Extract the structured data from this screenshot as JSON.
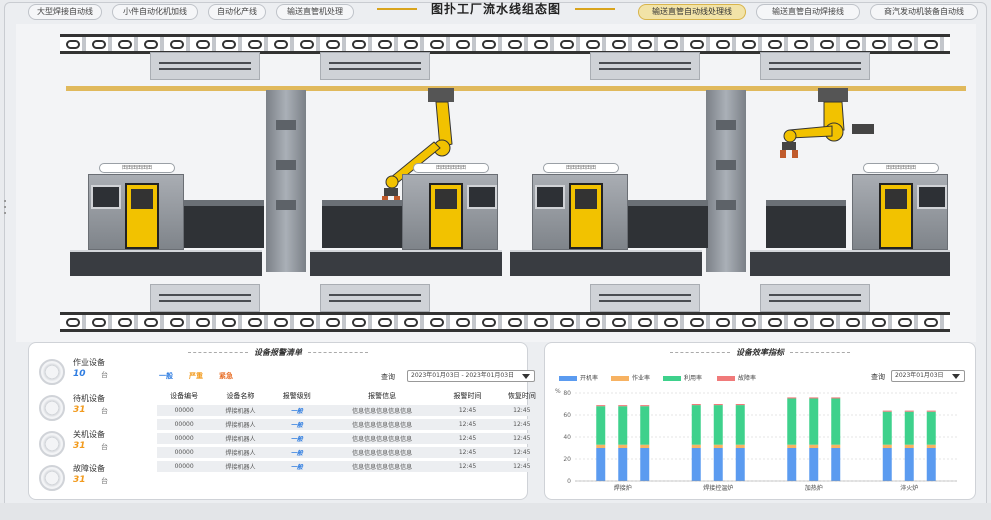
{
  "nav": {
    "left_tabs": [
      "大型焊接自动线",
      "小件自动化机加线",
      "自动化产线",
      "输送直管机处理"
    ],
    "title": "图扑工厂流水线组态图",
    "right_tabs": [
      "输送直管自动线处理线",
      "输送直管自动焊接线",
      "商汽发动机装备自动线"
    ],
    "active_right_index": 0
  },
  "scene": {
    "machine_tag": "田田田田田田"
  },
  "device_panel": {
    "title": "设备报警清单",
    "stats": [
      {
        "label": "作业设备",
        "value": "10",
        "unit": "台"
      },
      {
        "label": "待机设备",
        "value": "31",
        "unit": "台"
      },
      {
        "label": "关机设备",
        "value": "31",
        "unit": "台"
      },
      {
        "label": "故障设备",
        "value": "31",
        "unit": "台"
      }
    ],
    "filters": [
      "一般",
      "严重",
      "紧急"
    ],
    "query_label": "查询",
    "date_range": "2023年01月03日 - 2023年01月03日",
    "columns": [
      "设备编号",
      "设备名称",
      "报警级别",
      "报警信息",
      "报警时间",
      "恢复时间"
    ],
    "rows": [
      [
        "00000",
        "焊接机器人",
        "一般",
        "信息信息信息信息信息",
        "12:45",
        "12:45"
      ],
      [
        "00000",
        "焊接机器人",
        "一般",
        "信息信息信息信息信息",
        "12:45",
        "12:45"
      ],
      [
        "00000",
        "焊接机器人",
        "一般",
        "信息信息信息信息信息",
        "12:45",
        "12:45"
      ],
      [
        "00000",
        "焊接机器人",
        "一般",
        "信息信息信息信息信息",
        "12:45",
        "12:45"
      ],
      [
        "00000",
        "焊接机器人",
        "一般",
        "信息信息信息信息信息",
        "12:45",
        "12:45"
      ]
    ]
  },
  "efficiency_panel": {
    "title": "设备效率指标",
    "query_label": "查询",
    "date": "2023年01月03日",
    "legend_colors": {
      "开机率": "#5b9bf0",
      "作业率": "#f7b262",
      "利用率": "#3ed18c",
      "故障率": "#f07a7a"
    }
  },
  "chart_data": {
    "type": "bar",
    "ylabel": "%",
    "yticks": [
      0,
      20,
      40,
      60,
      80
    ],
    "ylim": [
      0,
      80
    ],
    "categories": [
      "焊接炉",
      "焊接控温炉",
      "加热炉",
      "淬火炉"
    ],
    "series": [
      {
        "name": "开机率",
        "color": "#5b9bf0",
        "values": [
          30,
          30,
          30,
          30,
          30,
          30,
          30,
          30,
          30,
          30,
          30,
          30
        ]
      },
      {
        "name": "作业率",
        "color": "#f7b262",
        "values": [
          3,
          3,
          3,
          3,
          3,
          3,
          3,
          3,
          3,
          3,
          3,
          3
        ]
      },
      {
        "name": "利用率",
        "color": "#3ed18c",
        "values": [
          35,
          35,
          35,
          36,
          36,
          36,
          42,
          42,
          42,
          30,
          30,
          30
        ]
      },
      {
        "name": "故障率",
        "color": "#f07a7a",
        "values": [
          1,
          1,
          1,
          1,
          1,
          1,
          1,
          1,
          1,
          1,
          1,
          1
        ]
      }
    ]
  }
}
